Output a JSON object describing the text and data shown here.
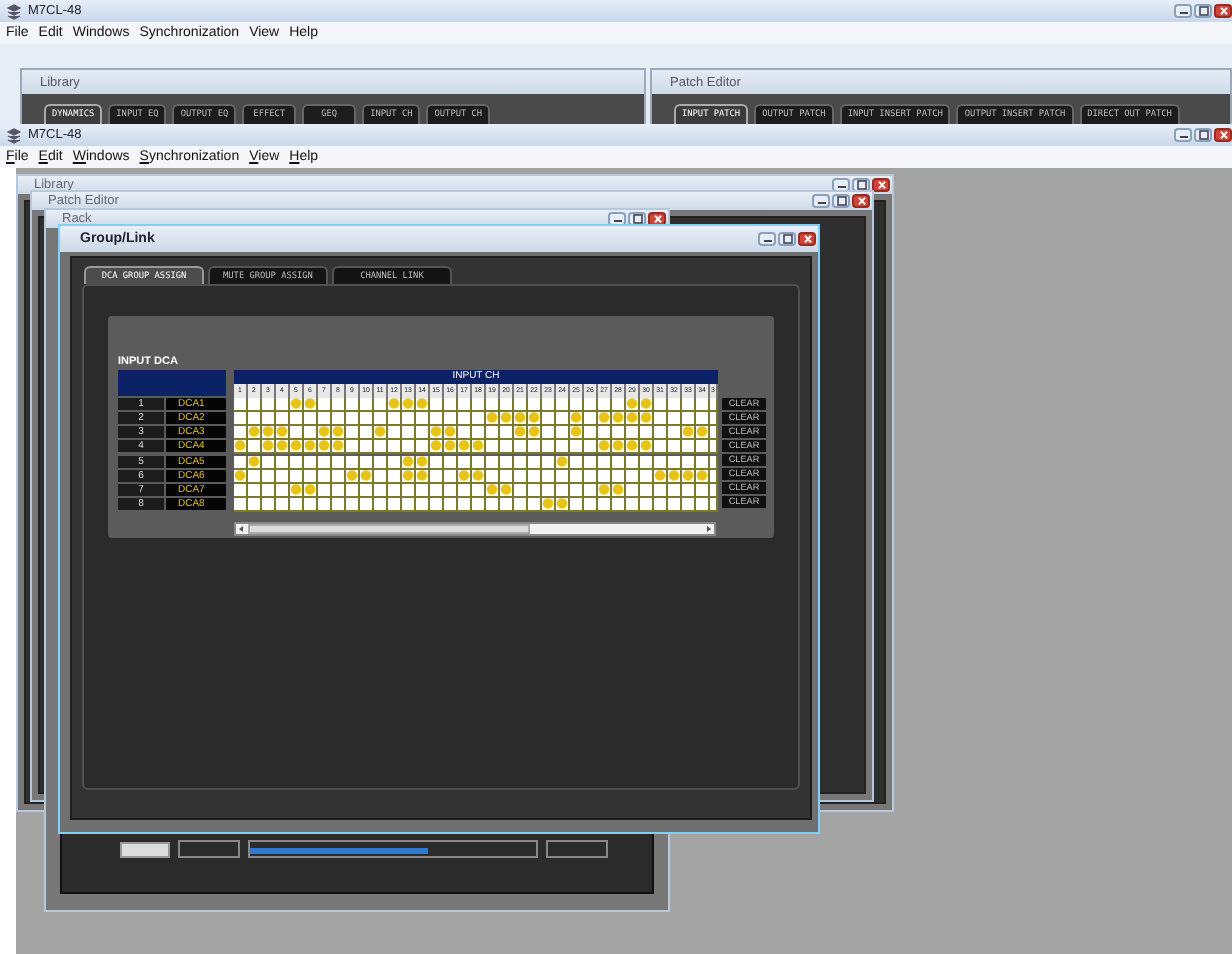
{
  "back_window": {
    "title": "M7CL-48",
    "mnemonics": false,
    "menu": [
      "File",
      "Edit",
      "Windows",
      "Synchronization",
      "View",
      "Help"
    ],
    "library": {
      "title": "Library",
      "tabs": [
        {
          "label": "DYNAMICS",
          "selected": true
        },
        {
          "label": "INPUT EQ",
          "selected": false
        },
        {
          "label": "OUTPUT EQ",
          "selected": false
        },
        {
          "label": "EFFECT",
          "selected": false
        },
        {
          "label": "GEQ",
          "selected": false
        },
        {
          "label": "INPUT CH",
          "selected": false
        },
        {
          "label": "OUTPUT CH",
          "selected": false
        }
      ]
    },
    "patch_editor": {
      "title": "Patch Editor",
      "tabs": [
        {
          "label": "INPUT PATCH",
          "selected": true
        },
        {
          "label": "OUTPUT PATCH",
          "selected": false
        },
        {
          "label": "INPUT INSERT PATCH",
          "selected": false
        },
        {
          "label": "OUTPUT INSERT PATCH",
          "selected": false
        },
        {
          "label": "DIRECT OUT PATCH",
          "selected": false
        }
      ]
    }
  },
  "front_window": {
    "title": "M7CL-48",
    "mnemonics": true,
    "menu": [
      "File",
      "Edit",
      "Windows",
      "Synchronization",
      "View",
      "Help"
    ],
    "library_window": {
      "title": "Library"
    },
    "patch_editor_window": {
      "title": "Patch Editor"
    },
    "rack_window": {
      "title": "Rack",
      "bar": {
        "level": 0.62
      }
    },
    "group_link": {
      "title": "Group/Link",
      "tabs": [
        {
          "label": "DCA GROUP ASSIGN",
          "selected": true
        },
        {
          "label": "MUTE GROUP ASSIGN",
          "selected": false
        },
        {
          "label": "CHANNEL LINK",
          "selected": false
        }
      ],
      "section_title": "INPUT DCA",
      "group_header": "INPUT CH",
      "columns": [
        "1",
        "2",
        "3",
        "4",
        "5",
        "6",
        "7",
        "8",
        "9",
        "10",
        "11",
        "12",
        "13",
        "14",
        "15",
        "16",
        "17",
        "18",
        "19",
        "20",
        "21",
        "22",
        "23",
        "24",
        "25",
        "26",
        "27",
        "28",
        "29",
        "30",
        "31",
        "32",
        "33",
        "34",
        "3"
      ],
      "rows": [
        {
          "number": "1",
          "name": "DCA1",
          "clear": "CLEAR",
          "assigned": [
            false,
            false,
            false,
            false,
            true,
            true,
            false,
            false,
            false,
            false,
            false,
            true,
            true,
            true,
            false,
            false,
            false,
            false,
            false,
            false,
            false,
            false,
            false,
            false,
            false,
            false,
            false,
            false,
            true,
            true,
            false,
            false,
            false,
            false,
            false
          ]
        },
        {
          "number": "2",
          "name": "DCA2",
          "clear": "CLEAR",
          "assigned": [
            false,
            false,
            false,
            false,
            false,
            false,
            false,
            false,
            false,
            false,
            false,
            false,
            false,
            false,
            false,
            false,
            false,
            false,
            true,
            true,
            true,
            true,
            false,
            false,
            true,
            false,
            true,
            true,
            true,
            true,
            false,
            false,
            false,
            false,
            false
          ]
        },
        {
          "number": "3",
          "name": "DCA3",
          "clear": "CLEAR",
          "assigned": [
            false,
            true,
            true,
            true,
            false,
            false,
            true,
            true,
            false,
            false,
            true,
            false,
            false,
            false,
            true,
            true,
            false,
            false,
            false,
            false,
            true,
            true,
            false,
            false,
            true,
            false,
            false,
            false,
            false,
            false,
            false,
            false,
            true,
            true,
            false
          ]
        },
        {
          "number": "4",
          "name": "DCA4",
          "clear": "CLEAR",
          "assigned": [
            true,
            false,
            true,
            true,
            true,
            true,
            true,
            true,
            false,
            false,
            false,
            false,
            false,
            false,
            true,
            true,
            true,
            true,
            false,
            false,
            false,
            false,
            false,
            false,
            false,
            false,
            true,
            true,
            true,
            true,
            false,
            false,
            false,
            false,
            false
          ]
        },
        {
          "number": "5",
          "name": "DCA5",
          "clear": "CLEAR",
          "assigned": [
            false,
            true,
            false,
            false,
            false,
            false,
            false,
            false,
            false,
            false,
            false,
            false,
            true,
            true,
            false,
            false,
            false,
            false,
            false,
            false,
            false,
            false,
            false,
            true,
            false,
            false,
            false,
            false,
            false,
            false,
            false,
            false,
            false,
            false,
            false
          ]
        },
        {
          "number": "6",
          "name": "DCA6",
          "clear": "CLEAR",
          "assigned": [
            true,
            false,
            false,
            false,
            false,
            false,
            false,
            false,
            true,
            true,
            false,
            false,
            true,
            true,
            false,
            false,
            true,
            true,
            false,
            false,
            false,
            false,
            false,
            false,
            false,
            false,
            false,
            false,
            false,
            false,
            true,
            true,
            true,
            true,
            false
          ]
        },
        {
          "number": "7",
          "name": "DCA7",
          "clear": "CLEAR",
          "assigned": [
            false,
            false,
            false,
            false,
            true,
            true,
            false,
            false,
            false,
            false,
            false,
            false,
            false,
            false,
            false,
            false,
            false,
            false,
            true,
            true,
            false,
            false,
            false,
            false,
            false,
            false,
            true,
            true,
            false,
            false,
            false,
            false,
            false,
            false,
            false
          ]
        },
        {
          "number": "8",
          "name": "DCA8",
          "clear": "CLEAR",
          "assigned": [
            false,
            false,
            false,
            false,
            false,
            false,
            false,
            false,
            false,
            false,
            false,
            false,
            false,
            false,
            false,
            false,
            false,
            false,
            false,
            false,
            false,
            false,
            true,
            true,
            false,
            false,
            false,
            false,
            false,
            false,
            false,
            false,
            false,
            false,
            false
          ]
        }
      ]
    }
  }
}
